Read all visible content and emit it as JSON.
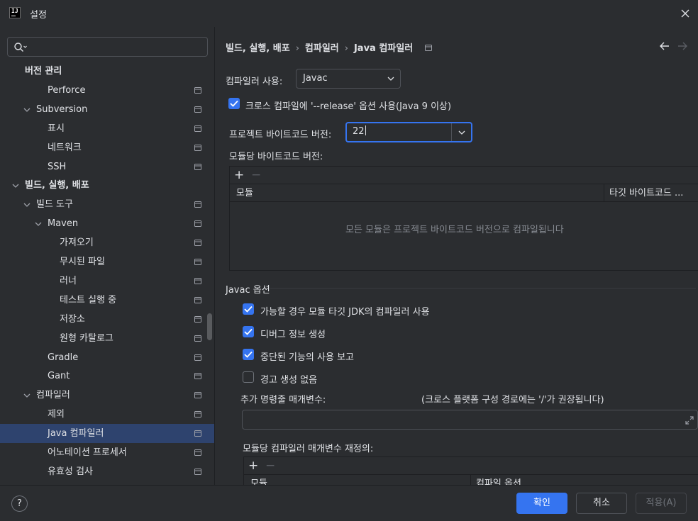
{
  "window": {
    "title": "설정"
  },
  "sidebar": {
    "items": [
      {
        "label": "버전 관리",
        "level": 0,
        "expandable": false,
        "section": true
      },
      {
        "label": "Perforce",
        "level": 2,
        "expandable": false,
        "page_icon": true
      },
      {
        "label": "Subversion",
        "level": 1,
        "expandable": true,
        "page_icon": true
      },
      {
        "label": "표시",
        "level": 2,
        "expandable": false,
        "page_icon": true
      },
      {
        "label": "네트워크",
        "level": 2,
        "expandable": false,
        "page_icon": true
      },
      {
        "label": "SSH",
        "level": 2,
        "expandable": false,
        "page_icon": true
      },
      {
        "label": "빌드, 실행, 배포",
        "level": 0,
        "expandable": true,
        "section": true
      },
      {
        "label": "빌드 도구",
        "level": 1,
        "expandable": true,
        "page_icon": true
      },
      {
        "label": "Maven",
        "level": 2,
        "expandable": true,
        "page_icon": true
      },
      {
        "label": "가져오기",
        "level": 3,
        "expandable": false,
        "page_icon": true
      },
      {
        "label": "무시된 파일",
        "level": 3,
        "expandable": false,
        "page_icon": true
      },
      {
        "label": "러너",
        "level": 3,
        "expandable": false,
        "page_icon": true
      },
      {
        "label": "테스트 실행 중",
        "level": 3,
        "expandable": false,
        "page_icon": true
      },
      {
        "label": "저장소",
        "level": 3,
        "expandable": false,
        "page_icon": true
      },
      {
        "label": "원형 카탈로그",
        "level": 3,
        "expandable": false,
        "page_icon": true
      },
      {
        "label": "Gradle",
        "level": 2,
        "expandable": false,
        "page_icon": true
      },
      {
        "label": "Gant",
        "level": 2,
        "expandable": false,
        "page_icon": true
      },
      {
        "label": "컴파일러",
        "level": 1,
        "expandable": true,
        "page_icon": true
      },
      {
        "label": "제외",
        "level": 2,
        "expandable": false,
        "page_icon": true
      },
      {
        "label": "Java 컴파일러",
        "level": 2,
        "expandable": false,
        "page_icon": true,
        "selected": true
      },
      {
        "label": "어노테이션 프로세서",
        "level": 2,
        "expandable": false,
        "page_icon": true
      },
      {
        "label": "유효성 검사",
        "level": 2,
        "expandable": false,
        "page_icon": true
      }
    ]
  },
  "breadcrumb": [
    "빌드, 실행, 배포",
    "컴파일러",
    "Java 컴파일러"
  ],
  "compiler": {
    "label": "컴파일러 사용:",
    "value": "Javac"
  },
  "release_option": {
    "label": "크로스 컴파일에 '--release' 옵션 사용(Java 9 이상)",
    "checked": true
  },
  "project_bytecode": {
    "label": "프로젝트 바이트코드 버전:",
    "value": "22"
  },
  "module_bytecode": {
    "label": "모듈당 바이트코드 버전:",
    "col_module": "모듈",
    "col_target": "타깃 바이트코드 ...",
    "empty_text": "모든 모듈은 프로젝트 바이트코드 버전으로 컴파일됩니다"
  },
  "javac_options": {
    "title": "Javac 옵션",
    "options": [
      {
        "label": "가능할 경우 모듈 타깃 JDK의 컴파일러 사용",
        "checked": true
      },
      {
        "label": "디버그 정보 생성",
        "checked": true
      },
      {
        "label": "중단된 기능의 사용 보고",
        "checked": true
      },
      {
        "label": "경고 생성 없음",
        "checked": false
      }
    ],
    "cmd_params_label": "추가 명령줄 매개변수:",
    "cmd_params_hint": "(크로스 플랫폼 구성 경로에는 '/'가 권장됩니다)",
    "cmd_params_value": "",
    "override_label": "모듈당 컴파일러 매개변수 재정의:",
    "override_col_module": "모듈",
    "override_col_options": "컴파일 옵션"
  },
  "footer": {
    "help": "?",
    "ok": "확인",
    "cancel": "취소",
    "apply": "적용(A)"
  },
  "colors": {
    "accent": "#3574f0",
    "selection": "#2e436e",
    "background": "#2b2d30"
  }
}
